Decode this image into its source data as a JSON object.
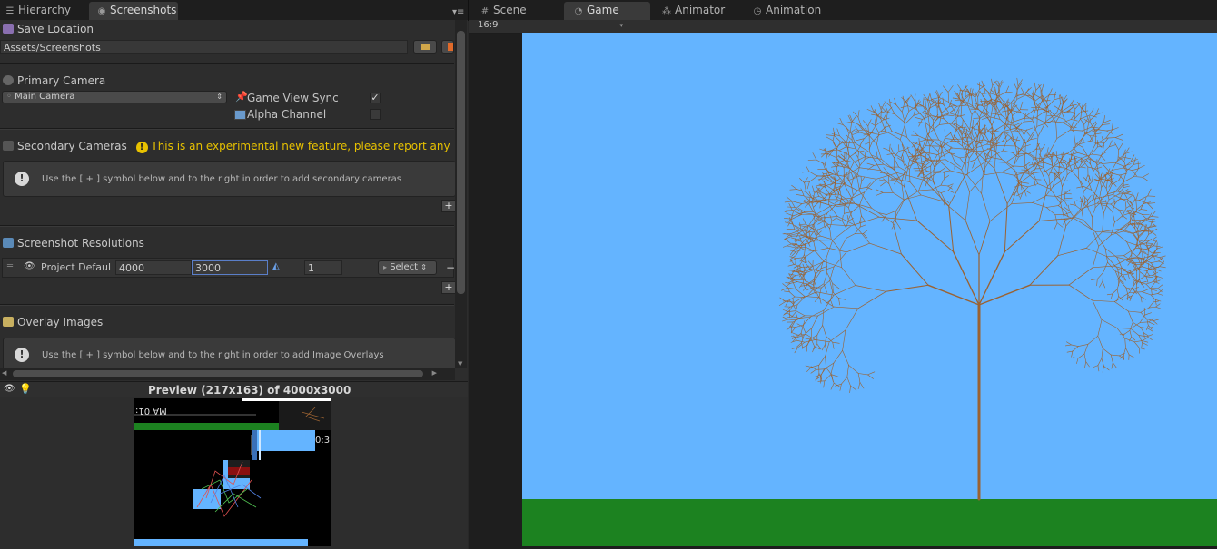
{
  "left_tabs": [
    {
      "label": "Hierarchy",
      "icon": "list-icon"
    },
    {
      "label": "Screenshots",
      "icon": "camera-icon"
    }
  ],
  "right_tabs": [
    {
      "label": "Scene",
      "icon": "grid-icon"
    },
    {
      "label": "Game",
      "icon": "pacman-icon"
    },
    {
      "label": "Animator",
      "icon": "nodes-icon"
    },
    {
      "label": "Animation",
      "icon": "clock-icon"
    }
  ],
  "save_location": {
    "title": "Save Location",
    "path": "Assets/Screenshots"
  },
  "primary_camera": {
    "title": "Primary Camera",
    "camera_value": "Main Camera",
    "game_view_sync_label": "Game View Sync",
    "game_view_sync_checked": true,
    "game_view_sync_mark": "✓",
    "alpha_channel_label": "Alpha Channel",
    "alpha_channel_checked": false
  },
  "secondary_cameras": {
    "title": "Secondary Cameras",
    "warning": "This is an experimental new feature, please report any issu",
    "info": "Use the [ + ] symbol below and to the right in order to add secondary cameras"
  },
  "resolutions": {
    "title": "Screenshot Resolutions",
    "row": {
      "name": "Project Defaul",
      "width": "4000",
      "height": "3000",
      "scale": "1",
      "select_label": "Select"
    }
  },
  "overlay_images": {
    "title": "Overlay Images",
    "info": "Use the [ + ] symbol below and to the right in order to add Image Overlays"
  },
  "preview": {
    "title": "Preview (217x163) of 4000x3000",
    "overlay_text_a": "MA 01:",
    "overlay_text_b": "0:3"
  },
  "game_view": {
    "aspect": "16:9"
  },
  "colors": {
    "sky": "#64b4ff",
    "ground": "#1c8220",
    "trunk": "#9a6232",
    "warning_text": "#e8c200",
    "selected_field": "#3c5a9a"
  }
}
